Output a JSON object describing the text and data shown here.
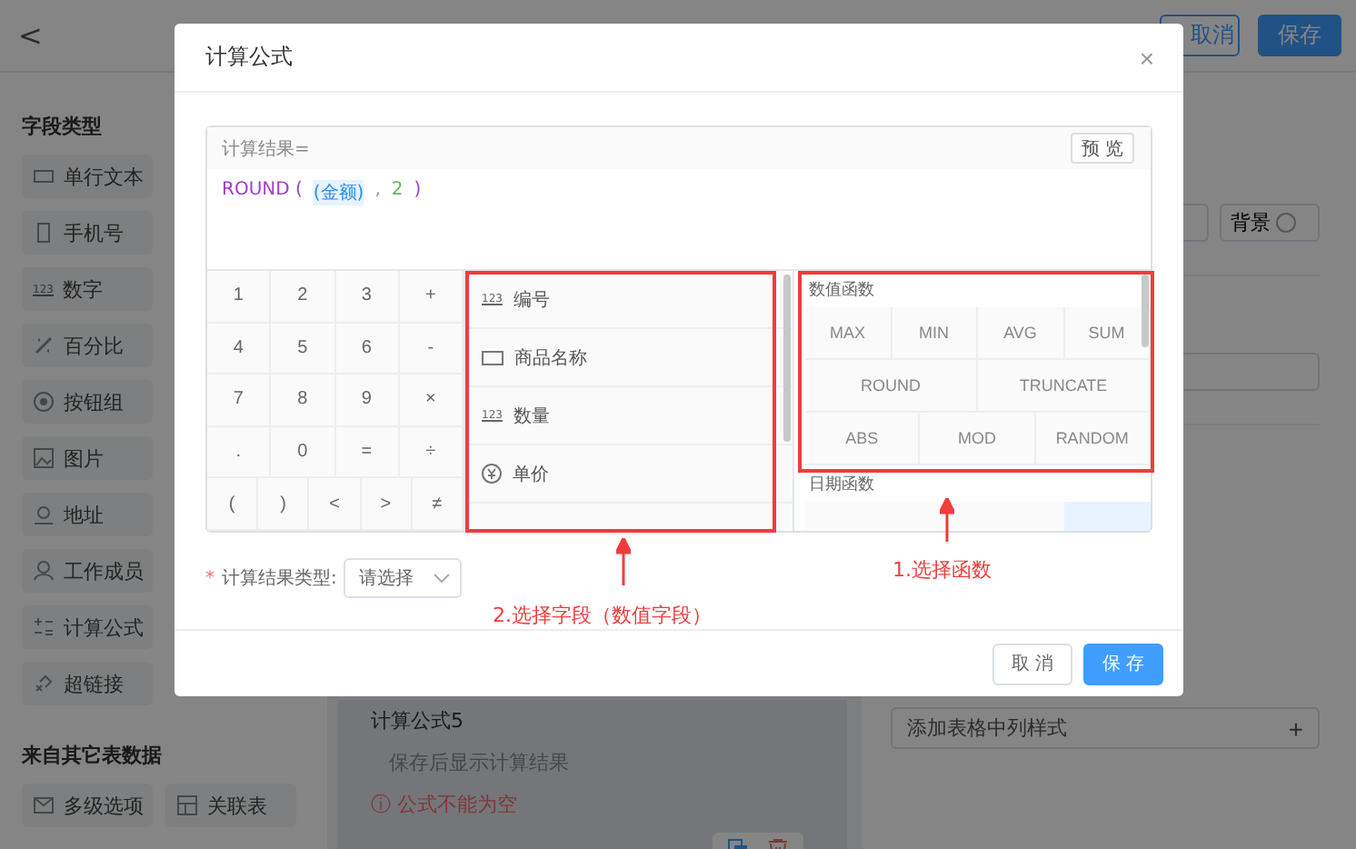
{
  "topbar": {
    "back": "<",
    "buttons": [
      {
        "label": "取消",
        "kind": "outline"
      },
      {
        "label": "保存",
        "kind": "primary"
      }
    ]
  },
  "sidebar": {
    "groups": [
      {
        "title": "字段类型",
        "kind": "list",
        "items": [
          {
            "label": "单行文本",
            "kind": "text"
          },
          {
            "label": "手机号",
            "kind": "phone"
          },
          {
            "label": "数字",
            "kind": "number",
            "tag": "123"
          },
          {
            "label": "百分比",
            "kind": "percent"
          },
          {
            "label": "按钮组",
            "kind": "radio"
          },
          {
            "label": "图片",
            "kind": "image"
          },
          {
            "label": "地址",
            "kind": "pin"
          },
          {
            "label": "工作成员",
            "kind": "user"
          },
          {
            "label": "计算公式",
            "kind": "calc"
          },
          {
            "label": "超链接",
            "kind": "link"
          }
        ]
      },
      {
        "title": "来自其它表数据",
        "kind": "grid",
        "items": [
          {
            "label": "多级选项",
            "kind": "mail"
          },
          {
            "label": "关联表",
            "kind": "table"
          }
        ]
      }
    ]
  },
  "canvas": {
    "field_title": "计算公式5",
    "hint": "保存后显示计算结果",
    "error": "ⓘ 公式不能为空"
  },
  "right_panel": {
    "background_button": "背景",
    "column_style": "添加表格中列样式",
    "add": "+"
  },
  "dialog": {
    "title": "计算公式",
    "close": "×",
    "result_label": "计算结果=",
    "preview": "预 览",
    "formula": [
      {
        "text": "ROUND (",
        "kind": "function"
      },
      {
        "text": "(金额)",
        "kind": "field"
      },
      {
        "text": ",",
        "kind": "separator"
      },
      {
        "text": "2",
        "kind": "number"
      },
      {
        "text": ")",
        "kind": "function"
      }
    ],
    "keypad": [
      [
        "1",
        "2",
        "3",
        "+"
      ],
      [
        "4",
        "5",
        "6",
        "-"
      ],
      [
        "7",
        "8",
        "9",
        "×"
      ],
      [
        ".",
        "0",
        "=",
        "÷"
      ],
      [
        "(",
        ")",
        "<",
        ">",
        "≠"
      ]
    ],
    "fields": [
      {
        "label": "编号",
        "kind": "number",
        "tag": "123"
      },
      {
        "label": "商品名称",
        "kind": "text"
      },
      {
        "label": "数量",
        "kind": "number",
        "tag": "123"
      },
      {
        "label": "单价",
        "kind": "money"
      }
    ],
    "function_groups": [
      {
        "title": "数值函数",
        "rows": [
          {
            "functions": [
              "MAX",
              "MIN",
              "AVG",
              "SUM"
            ]
          },
          {
            "functions": [
              "ROUND",
              "TRUNCATE"
            ]
          },
          {
            "functions": [
              "ABS",
              "MOD",
              "RANDOM"
            ]
          }
        ]
      },
      {
        "title": "日期函数"
      }
    ],
    "result_type": {
      "required_mark": "*",
      "label": "计算结果类型:",
      "placeholder": "请选择"
    },
    "buttons": [
      {
        "label": "取 消",
        "kind": "outline"
      },
      {
        "label": "保 存",
        "kind": "primary"
      }
    ]
  },
  "annotations": [
    {
      "text": "2.选择字段（数值字段）"
    },
    {
      "text": "1.选择函数"
    }
  ]
}
